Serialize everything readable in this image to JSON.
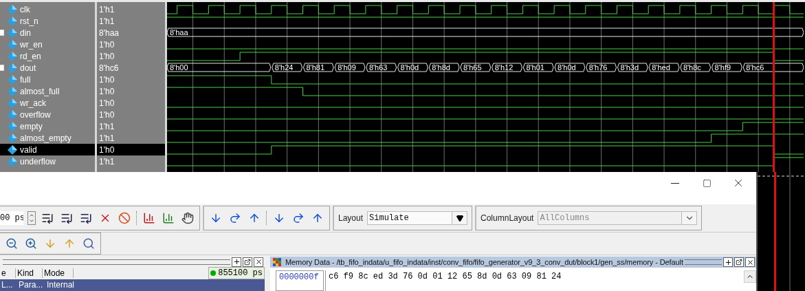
{
  "wave": {
    "signals": [
      {
        "name": "clk",
        "value": "1'h1",
        "kind": "clock",
        "selected": false
      },
      {
        "name": "rst_n",
        "value": "1'h1",
        "kind": "bit",
        "selected": false
      },
      {
        "name": "din",
        "value": "8'haa",
        "kind": "bus",
        "segments": [
          "8'haa"
        ],
        "selected": false
      },
      {
        "name": "wr_en",
        "value": "1'h0",
        "kind": "bit",
        "selected": false
      },
      {
        "name": "rd_en",
        "value": "1'h0",
        "kind": "bit",
        "selected": false
      },
      {
        "name": "dout",
        "value": "8'hc6",
        "kind": "bus",
        "segments": [
          "8'h00",
          "8'h24",
          "8'h81",
          "8'h09",
          "8'h63",
          "8'h0d",
          "8'h8d",
          "8'h65",
          "8'h12",
          "8'h01",
          "8'h0d",
          "8'h76",
          "8'h3d",
          "8'hed",
          "8'h8c",
          "8'hf9",
          "8'hc6"
        ],
        "selected": false
      },
      {
        "name": "full",
        "value": "1'h0",
        "kind": "bit",
        "selected": false
      },
      {
        "name": "almost_full",
        "value": "1'h0",
        "kind": "bit",
        "selected": false
      },
      {
        "name": "wr_ack",
        "value": "1'h0",
        "kind": "bit",
        "selected": false
      },
      {
        "name": "overflow",
        "value": "1'h0",
        "kind": "bit",
        "selected": false
      },
      {
        "name": "empty",
        "value": "1'h1",
        "kind": "bit",
        "selected": false
      },
      {
        "name": "almost_empty",
        "value": "1'h1",
        "kind": "bit",
        "selected": false
      },
      {
        "name": "valid",
        "value": "1'h0",
        "kind": "bit",
        "selected": true
      },
      {
        "name": "underflow",
        "value": "1'h1",
        "kind": "bit",
        "selected": false
      }
    ]
  },
  "toolbar": {
    "time_field": "00 ps",
    "layout": {
      "label": "Layout",
      "value": "Simulate"
    },
    "column_layout": {
      "label": "ColumnLayout",
      "value": "AllColumns",
      "disabled": true
    }
  },
  "objects_panel": {
    "columns": [
      "e",
      "Kind",
      "Mode"
    ],
    "time": "855100 ps",
    "rows": [
      {
        "cells": [
          "L...",
          "Para...",
          "Internal"
        ],
        "selected": true
      }
    ]
  },
  "memory_panel": {
    "title": "Memory Data - /tb_fifo_indata/u_fifo_indata/inst/conv_fifo/fifo_generator_v9_3_conv_dut/block1/gen_ss/memory - Default",
    "rows": [
      {
        "address": "0000000f",
        "data": "c6 f9 8c ed 3d 76 0d 01 12 65 8d 0d 63 09 81 24"
      }
    ]
  }
}
